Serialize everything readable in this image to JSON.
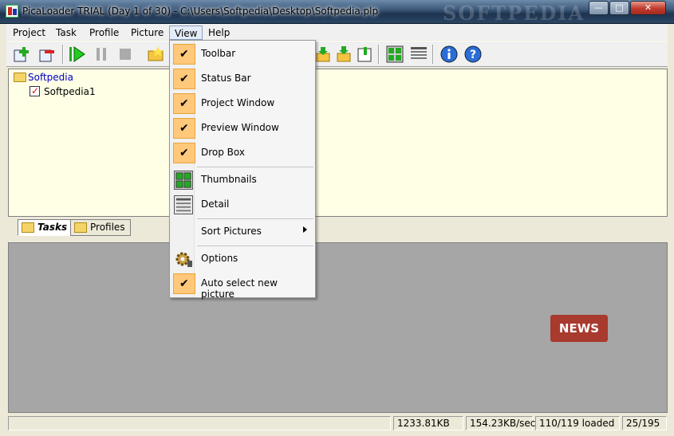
{
  "window": {
    "title": "PicaLoader TRIAL (Day 1 of 30) - C:\\Users\\Softpedia\\Desktop\\Softpedia.plp",
    "watermark": "SOFTPEDIA",
    "min_glyph": "—",
    "max_glyph": "□",
    "close_glyph": "✕"
  },
  "menubar": {
    "items": [
      {
        "label": "Project"
      },
      {
        "label": "Task"
      },
      {
        "label": "Profile"
      },
      {
        "label": "Picture"
      },
      {
        "label": "View"
      },
      {
        "label": "Help"
      }
    ]
  },
  "toolbar": {
    "icons": [
      "add-project-icon",
      "remove-project-icon",
      "start-icon",
      "pause-icon",
      "stop-icon",
      "open-folder-icon",
      "download-icon",
      "download-all-icon",
      "profile-icon",
      "thumbnails-view-icon",
      "detail-view-icon",
      "info-icon",
      "help-icon"
    ]
  },
  "tree": {
    "root": "Softpedia",
    "child": "Softpedia1"
  },
  "tabs": [
    {
      "label": "Tasks",
      "selected": true
    },
    {
      "label": "Profiles",
      "selected": false
    }
  ],
  "preview": {
    "badge": "NEWS"
  },
  "status": {
    "size": "1233.81KB",
    "speed": "154.23KB/sec",
    "loaded": "110/119 loaded",
    "count": "25/195"
  },
  "view_menu": {
    "items": [
      {
        "label": "Toolbar",
        "checked": true
      },
      {
        "label": "Status Bar",
        "checked": true
      },
      {
        "label": "Project Window",
        "checked": true
      },
      {
        "label": "Preview Window",
        "checked": true
      },
      {
        "label": "Drop Box",
        "checked": true
      },
      {
        "label": "Thumbnails",
        "icon": "thumbnails-icon"
      },
      {
        "label": "Detail",
        "icon": "detail-list-icon"
      },
      {
        "label": "Sort Pictures",
        "submenu": true
      },
      {
        "label": "Options",
        "icon": "options-gear-icon"
      },
      {
        "label": "Auto select new picture",
        "checked": true
      }
    ]
  },
  "colors": {
    "accent_check": "#ffc87a",
    "tree_bg": "#ffffe6",
    "preview_bg": "#a6a6a6",
    "news_badge": "#a83a2e"
  }
}
